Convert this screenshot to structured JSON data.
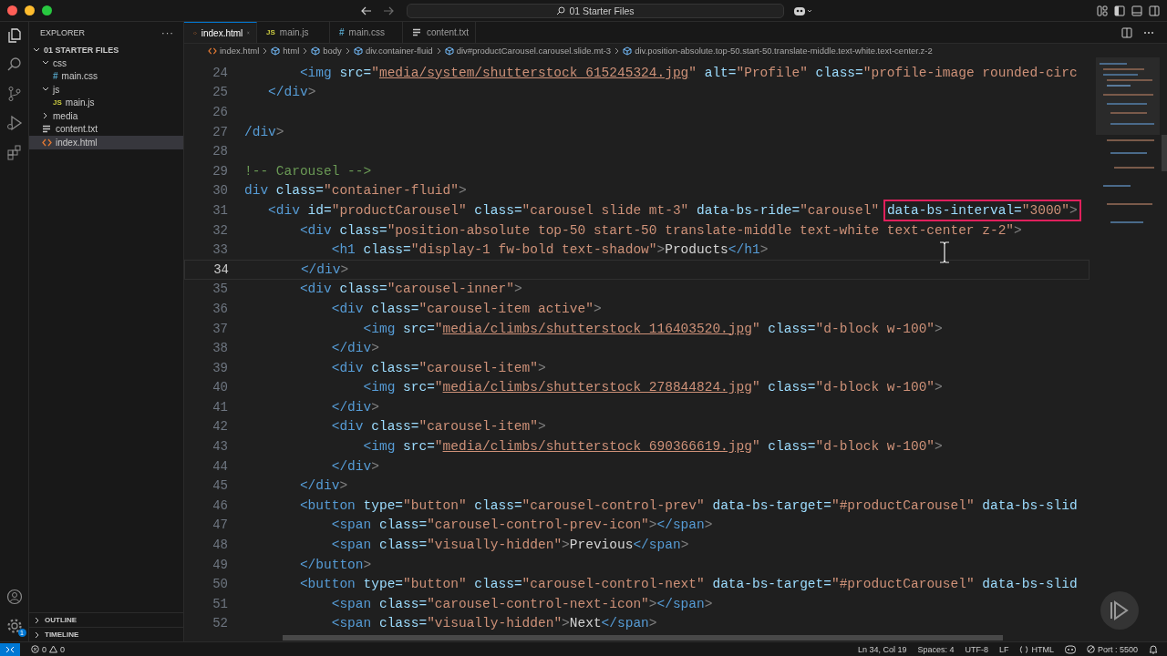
{
  "window": {
    "title": "01 Starter Files"
  },
  "activity_bar": {
    "items": [
      {
        "kind": "explorer",
        "selected": true
      },
      {
        "kind": "search",
        "selected": false
      },
      {
        "kind": "source-control",
        "selected": false
      },
      {
        "kind": "run",
        "selected": false
      },
      {
        "kind": "extensions",
        "selected": false
      }
    ],
    "settings_badge": "1"
  },
  "explorer": {
    "title": "EXPLORER",
    "more": "···",
    "section": {
      "label": "01 STARTER FILES",
      "expanded": true,
      "items": [
        {
          "label": "css",
          "kind": "folder",
          "expanded": true,
          "selected": false,
          "children": [
            {
              "label": "main.css",
              "kind": "css",
              "icon": "#",
              "selected": false
            }
          ]
        },
        {
          "label": "js",
          "kind": "folder",
          "expanded": true,
          "selected": false,
          "children": [
            {
              "label": "main.js",
              "kind": "js",
              "icon": "JS",
              "selected": false
            }
          ]
        },
        {
          "label": "media",
          "kind": "folder",
          "expanded": false,
          "selected": false
        },
        {
          "label": "content.txt",
          "kind": "txt",
          "selected": false
        },
        {
          "label": "index.html",
          "kind": "html",
          "selected": true
        }
      ]
    },
    "panels": [
      {
        "label": "OUTLINE",
        "expanded": false
      },
      {
        "label": "TIMELINE",
        "expanded": false
      }
    ]
  },
  "tabs": [
    {
      "label": "index.html",
      "kind": "html",
      "selected": true
    },
    {
      "label": "main.js",
      "kind": "js",
      "icon": "JS",
      "selected": false
    },
    {
      "label": "main.css",
      "kind": "css",
      "icon": "#",
      "selected": false
    },
    {
      "label": "content.txt",
      "kind": "txt",
      "selected": false
    }
  ],
  "breadcrumbs": [
    {
      "label": "index.html",
      "kind": "html"
    },
    {
      "label": "html",
      "kind": "element"
    },
    {
      "label": "body",
      "kind": "element"
    },
    {
      "label": "div.container-fluid",
      "kind": "element"
    },
    {
      "label": "div#productCarousel.carousel.slide.mt-3",
      "kind": "element"
    },
    {
      "label": "div.position-absolute.top-50.start-50.translate-middle.text-white.text-center.z-2",
      "kind": "element"
    }
  ],
  "editor": {
    "lines": [
      {
        "number": "24",
        "current": false,
        "tokens": [
          {
            "kind": "tag",
            "text": "       <img"
          },
          {
            "kind": "attr",
            "text": " src="
          },
          {
            "kind": "string",
            "text": "\""
          },
          {
            "kind": "link",
            "text": "media/system/shutterstock_615245324.jpg"
          },
          {
            "kind": "string",
            "text": "\""
          },
          {
            "kind": "attr",
            "text": " alt="
          },
          {
            "kind": "string",
            "text": "\"Profile\""
          },
          {
            "kind": "attr",
            "text": " class="
          },
          {
            "kind": "string",
            "text": "\"profile-image rounded-circ"
          }
        ]
      },
      {
        "number": "25",
        "current": false,
        "tokens": [
          {
            "kind": "tag",
            "text": "   </div"
          },
          {
            "kind": "punct",
            "text": ">"
          }
        ]
      },
      {
        "number": "26",
        "current": false
      },
      {
        "number": "27",
        "current": false,
        "tokens": [
          {
            "kind": "tag",
            "text": "/div"
          },
          {
            "kind": "punct",
            "text": ">"
          }
        ]
      },
      {
        "number": "28",
        "current": false
      },
      {
        "number": "29",
        "current": false,
        "tokens": [
          {
            "kind": "comment",
            "text": "!-- Carousel -->"
          }
        ]
      },
      {
        "number": "30",
        "current": false,
        "tokens": [
          {
            "kind": "tag",
            "text": "div"
          },
          {
            "kind": "attr",
            "text": " class="
          },
          {
            "kind": "string",
            "text": "\"container-fluid\""
          },
          {
            "kind": "punct",
            "text": ">"
          }
        ]
      },
      {
        "number": "31",
        "current": false,
        "tokens": [
          {
            "kind": "tag",
            "text": "   <div"
          },
          {
            "kind": "attr",
            "text": " id="
          },
          {
            "kind": "string",
            "text": "\"productCarousel\""
          },
          {
            "kind": "attr",
            "text": " class="
          },
          {
            "kind": "string",
            "text": "\"carousel slide mt-3\""
          },
          {
            "kind": "attr",
            "text": " data-bs-ride="
          },
          {
            "kind": "string",
            "text": "\"carousel\" "
          },
          {
            "kind": "boxed",
            "tokens": [
              {
                "kind": "attr",
                "text": "data-bs-interval="
              },
              {
                "kind": "string",
                "text": "\"3000\""
              },
              {
                "kind": "punct",
                "text": ">"
              }
            ]
          }
        ]
      },
      {
        "number": "32",
        "current": false,
        "tokens": [
          {
            "kind": "tag",
            "text": "       <div"
          },
          {
            "kind": "attr",
            "text": " class="
          },
          {
            "kind": "string",
            "text": "\"position-absolute top-50 start-50 translate-middle text-white text-center z-2\""
          },
          {
            "kind": "punct",
            "text": ">"
          }
        ]
      },
      {
        "number": "33",
        "current": false,
        "tokens": [
          {
            "kind": "tag",
            "text": "           <h1"
          },
          {
            "kind": "attr",
            "text": " class="
          },
          {
            "kind": "string",
            "text": "\"display-1 fw-bold text-shadow\""
          },
          {
            "kind": "punct",
            "text": ">"
          },
          {
            "kind": "text",
            "text": "Products"
          },
          {
            "kind": "tag",
            "text": "</h1"
          },
          {
            "kind": "punct",
            "text": ">"
          }
        ]
      },
      {
        "number": "34",
        "current": true,
        "tokens": [
          {
            "kind": "tag",
            "text": "       </div"
          },
          {
            "kind": "punct",
            "text": ">"
          }
        ]
      },
      {
        "number": "35",
        "current": false,
        "tokens": [
          {
            "kind": "tag",
            "text": "       <div"
          },
          {
            "kind": "attr",
            "text": " class="
          },
          {
            "kind": "string",
            "text": "\"carousel-inner\""
          },
          {
            "kind": "punct",
            "text": ">"
          }
        ]
      },
      {
        "number": "36",
        "current": false,
        "tokens": [
          {
            "kind": "tag",
            "text": "           <div"
          },
          {
            "kind": "attr",
            "text": " class="
          },
          {
            "kind": "string",
            "text": "\"carousel-item active\""
          },
          {
            "kind": "punct",
            "text": ">"
          }
        ]
      },
      {
        "number": "37",
        "current": false,
        "tokens": [
          {
            "kind": "tag",
            "text": "               <img"
          },
          {
            "kind": "attr",
            "text": " src="
          },
          {
            "kind": "string",
            "text": "\""
          },
          {
            "kind": "link",
            "text": "media/climbs/shutterstock_116403520.jpg"
          },
          {
            "kind": "string",
            "text": "\""
          },
          {
            "kind": "attr",
            "text": " class="
          },
          {
            "kind": "string",
            "text": "\"d-block w-100\""
          },
          {
            "kind": "punct",
            "text": ">"
          }
        ]
      },
      {
        "number": "38",
        "current": false,
        "tokens": [
          {
            "kind": "tag",
            "text": "           </div"
          },
          {
            "kind": "punct",
            "text": ">"
          }
        ]
      },
      {
        "number": "39",
        "current": false,
        "tokens": [
          {
            "kind": "tag",
            "text": "           <div"
          },
          {
            "kind": "attr",
            "text": " class="
          },
          {
            "kind": "string",
            "text": "\"carousel-item\""
          },
          {
            "kind": "punct",
            "text": ">"
          }
        ]
      },
      {
        "number": "40",
        "current": false,
        "tokens": [
          {
            "kind": "tag",
            "text": "               <img"
          },
          {
            "kind": "attr",
            "text": " src="
          },
          {
            "kind": "string",
            "text": "\""
          },
          {
            "kind": "link",
            "text": "media/climbs/shutterstock_278844824.jpg"
          },
          {
            "kind": "string",
            "text": "\""
          },
          {
            "kind": "attr",
            "text": " class="
          },
          {
            "kind": "string",
            "text": "\"d-block w-100\""
          },
          {
            "kind": "punct",
            "text": ">"
          }
        ]
      },
      {
        "number": "41",
        "current": false,
        "tokens": [
          {
            "kind": "tag",
            "text": "           </div"
          },
          {
            "kind": "punct",
            "text": ">"
          }
        ]
      },
      {
        "number": "42",
        "current": false,
        "tokens": [
          {
            "kind": "tag",
            "text": "           <div"
          },
          {
            "kind": "attr",
            "text": " class="
          },
          {
            "kind": "string",
            "text": "\"carousel-item\""
          },
          {
            "kind": "punct",
            "text": ">"
          }
        ]
      },
      {
        "number": "43",
        "current": false,
        "tokens": [
          {
            "kind": "tag",
            "text": "               <img"
          },
          {
            "kind": "attr",
            "text": " src="
          },
          {
            "kind": "string",
            "text": "\""
          },
          {
            "kind": "link",
            "text": "media/climbs/shutterstock_690366619.jpg"
          },
          {
            "kind": "string",
            "text": "\""
          },
          {
            "kind": "attr",
            "text": " class="
          },
          {
            "kind": "string",
            "text": "\"d-block w-100\""
          },
          {
            "kind": "punct",
            "text": ">"
          }
        ]
      },
      {
        "number": "44",
        "current": false,
        "tokens": [
          {
            "kind": "tag",
            "text": "           </div"
          },
          {
            "kind": "punct",
            "text": ">"
          }
        ]
      },
      {
        "number": "45",
        "current": false,
        "tokens": [
          {
            "kind": "tag",
            "text": "       </div"
          },
          {
            "kind": "punct",
            "text": ">"
          }
        ]
      },
      {
        "number": "46",
        "current": false,
        "tokens": [
          {
            "kind": "tag",
            "text": "       <button"
          },
          {
            "kind": "attr",
            "text": " type="
          },
          {
            "kind": "string",
            "text": "\"button\""
          },
          {
            "kind": "attr",
            "text": " class="
          },
          {
            "kind": "string",
            "text": "\"carousel-control-prev\""
          },
          {
            "kind": "attr",
            "text": " data-bs-target="
          },
          {
            "kind": "string",
            "text": "\"#productCarousel\""
          },
          {
            "kind": "attr",
            "text": " data-bs-slid"
          }
        ]
      },
      {
        "number": "47",
        "current": false,
        "tokens": [
          {
            "kind": "tag",
            "text": "           <span"
          },
          {
            "kind": "attr",
            "text": " class="
          },
          {
            "kind": "string",
            "text": "\"carousel-control-prev-icon\""
          },
          {
            "kind": "punct",
            "text": ">"
          },
          {
            "kind": "tag",
            "text": "</span"
          },
          {
            "kind": "punct",
            "text": ">"
          }
        ]
      },
      {
        "number": "48",
        "current": false,
        "tokens": [
          {
            "kind": "tag",
            "text": "           <span"
          },
          {
            "kind": "attr",
            "text": " class="
          },
          {
            "kind": "string",
            "text": "\"visually-hidden\""
          },
          {
            "kind": "punct",
            "text": ">"
          },
          {
            "kind": "text",
            "text": "Previous"
          },
          {
            "kind": "tag",
            "text": "</span"
          },
          {
            "kind": "punct",
            "text": ">"
          }
        ]
      },
      {
        "number": "49",
        "current": false,
        "tokens": [
          {
            "kind": "tag",
            "text": "       </button"
          },
          {
            "kind": "punct",
            "text": ">"
          }
        ]
      },
      {
        "number": "50",
        "current": false,
        "tokens": [
          {
            "kind": "tag",
            "text": "       <button"
          },
          {
            "kind": "attr",
            "text": " type="
          },
          {
            "kind": "string",
            "text": "\"button\""
          },
          {
            "kind": "attr",
            "text": " class="
          },
          {
            "kind": "string",
            "text": "\"carousel-control-next\""
          },
          {
            "kind": "attr",
            "text": " data-bs-target="
          },
          {
            "kind": "string",
            "text": "\"#productCarousel\""
          },
          {
            "kind": "attr",
            "text": " data-bs-slid"
          }
        ]
      },
      {
        "number": "51",
        "current": false,
        "tokens": [
          {
            "kind": "tag",
            "text": "           <span"
          },
          {
            "kind": "attr",
            "text": " class="
          },
          {
            "kind": "string",
            "text": "\"carousel-control-next-icon\""
          },
          {
            "kind": "punct",
            "text": ">"
          },
          {
            "kind": "tag",
            "text": "</span"
          },
          {
            "kind": "punct",
            "text": ">"
          }
        ]
      },
      {
        "number": "52",
        "current": false,
        "tokens": [
          {
            "kind": "tag",
            "text": "           <span"
          },
          {
            "kind": "attr",
            "text": " class="
          },
          {
            "kind": "string",
            "text": "\"visually-hidden\""
          },
          {
            "kind": "punct",
            "text": ">"
          },
          {
            "kind": "text",
            "text": "Next"
          },
          {
            "kind": "tag",
            "text": "</span"
          },
          {
            "kind": "punct",
            "text": ">"
          }
        ]
      }
    ]
  },
  "status_bar": {
    "problems": {
      "errors": "0",
      "warnings": "0"
    },
    "items": [
      {
        "kind": "text",
        "text": "Ln 34, Col 19"
      },
      {
        "kind": "text",
        "text": "Spaces: 4"
      },
      {
        "kind": "text",
        "text": "UTF-8"
      },
      {
        "kind": "text",
        "text": "LF"
      },
      {
        "kind": "language",
        "text": "HTML"
      },
      {
        "kind": "copilot"
      },
      {
        "kind": "port",
        "text": "Port : 5500"
      },
      {
        "kind": "bell"
      }
    ]
  }
}
